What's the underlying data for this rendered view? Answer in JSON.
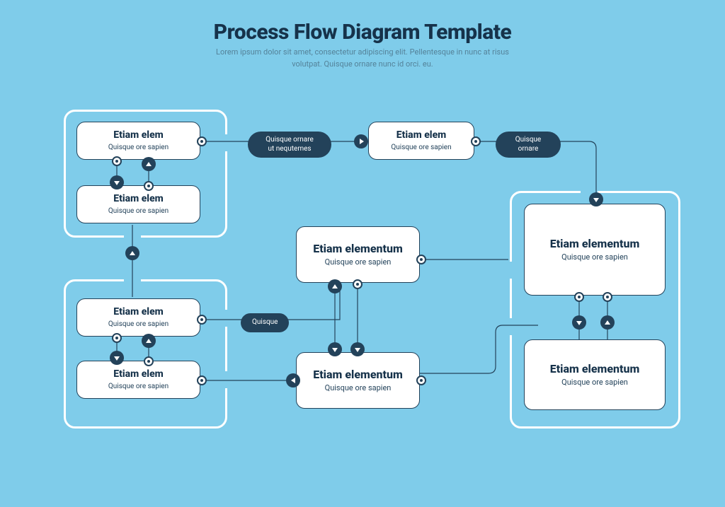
{
  "header": {
    "title": "Process Flow Diagram Template",
    "subtitle_line1": "Lorem ipsum dolor sit amet, consectetur adipiscing elit. Pellentesque in nunc at risus",
    "subtitle_line2": "volutpat. Quisque ornare nunc id orci. eu."
  },
  "nodes": {
    "n1": {
      "title": "Etiam elem",
      "sub": "Quisque ore sapien"
    },
    "n2": {
      "title": "Etiam elem",
      "sub": "Quisque ore sapien"
    },
    "n3": {
      "title": "Etiam elem",
      "sub": "Quisque ore sapien"
    },
    "n4": {
      "title": "Etiam elem",
      "sub": "Quisque ore sapien"
    },
    "n5": {
      "title": "Etiam elem",
      "sub": "Quisque ore sapien"
    },
    "n6": {
      "title": "Etiam elementum",
      "sub": "Quisque ore sapien"
    },
    "n7": {
      "title": "Etiam elementum",
      "sub": "Quisque ore sapien"
    },
    "n8": {
      "title": "Etiam elementum",
      "sub": "Quisque ore sapien"
    },
    "n9": {
      "title": "Etiam elementum",
      "sub": "Quisque ore sapien"
    }
  },
  "pills": {
    "p1_line1": "Quisque ornare",
    "p1_line2": "ut nequtemes",
    "p2_line1": "Quisque",
    "p2_line2": "ornare",
    "p3": "Quisque"
  },
  "colors": {
    "bg": "#7fccea",
    "dark": "#23425a",
    "white": "#ffffff"
  }
}
